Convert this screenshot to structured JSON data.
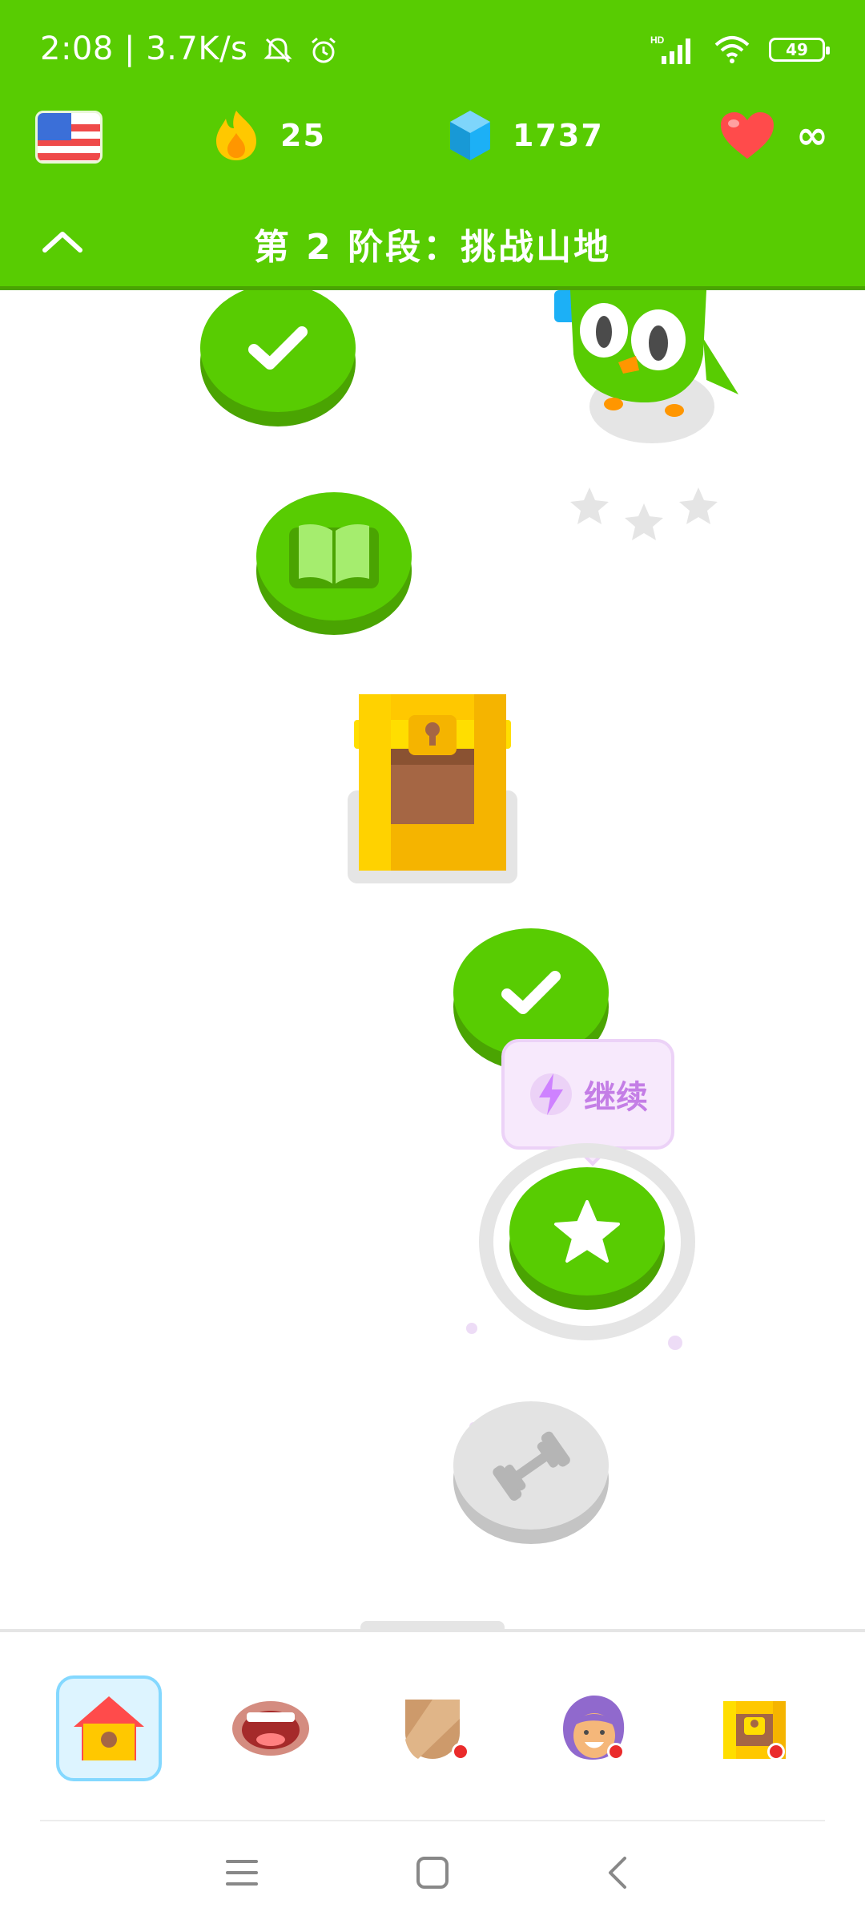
{
  "status_bar": {
    "time": "2:08",
    "network_speed": "3.7K/s",
    "network_label": "HD",
    "battery": "49"
  },
  "header": {
    "language_flag": "us-flag-icon",
    "streak": "25",
    "gems": "1737",
    "hearts": "∞",
    "section_title": "第 2 阶段：挑战山地"
  },
  "path": {
    "continue_label": "继续",
    "nodes": [
      {
        "type": "completed",
        "icon": "check-icon"
      },
      {
        "type": "story",
        "icon": "book-icon"
      },
      {
        "type": "chest",
        "icon": "treasure-chest-icon"
      },
      {
        "type": "completed",
        "icon": "check-icon"
      },
      {
        "type": "current",
        "icon": "star-icon"
      },
      {
        "type": "locked",
        "icon": "dumbbell-icon"
      }
    ],
    "mascot": "duo-owl-icon",
    "mascot_stars": 3
  },
  "bottom_nav": {
    "items": [
      {
        "name": "home",
        "icon": "home-icon",
        "active": true
      },
      {
        "name": "speak",
        "icon": "mouth-icon",
        "badge": false
      },
      {
        "name": "leagues",
        "icon": "shield-icon",
        "badge": true
      },
      {
        "name": "profile",
        "icon": "avatar-icon",
        "badge": true
      },
      {
        "name": "shop",
        "icon": "chest-icon",
        "badge": true
      }
    ]
  },
  "colors": {
    "brand_green": "#58cc02",
    "brand_green_dark": "#4aa402",
    "tooltip_purple": "#c47ee6",
    "heart_red": "#ff4b4b",
    "gem_blue": "#1cb0f6",
    "gold": "#ffc800"
  }
}
